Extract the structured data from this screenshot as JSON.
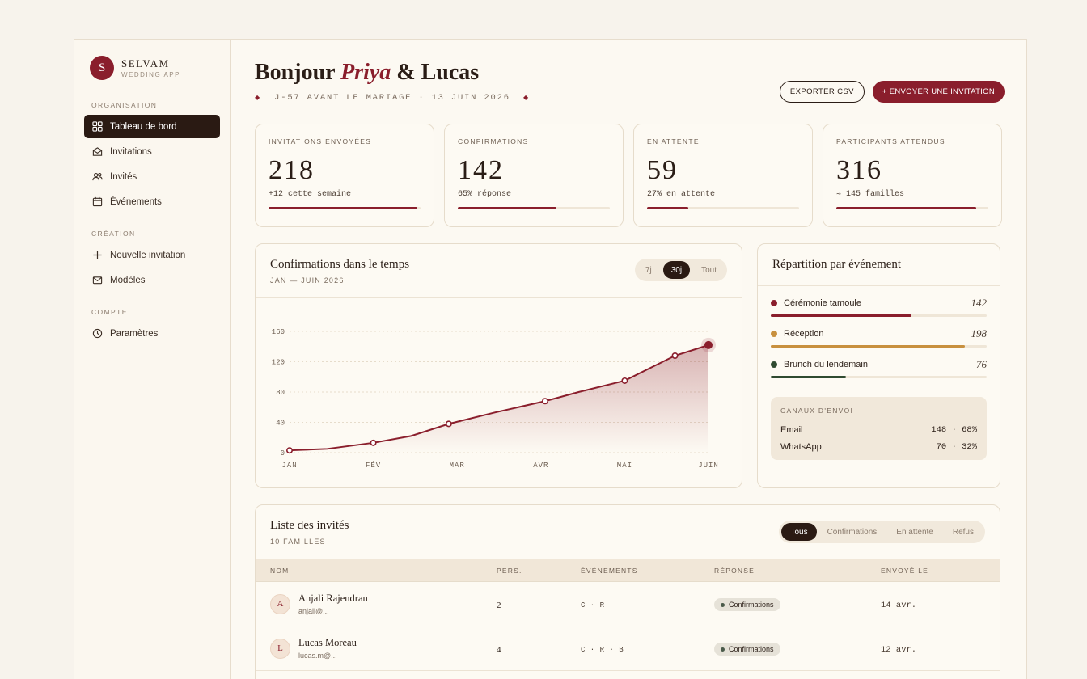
{
  "brand": {
    "initial": "S",
    "name": "SELVAM",
    "sub": "WEDDING APP"
  },
  "sidebar": {
    "sections": [
      {
        "title": "ORGANISATION",
        "items": [
          {
            "label": "Tableau de bord",
            "icon": "grid-icon",
            "active": true
          },
          {
            "label": "Invitations",
            "icon": "envelope-icon"
          },
          {
            "label": "Invités",
            "icon": "users-icon"
          },
          {
            "label": "Événements",
            "icon": "calendar-icon"
          }
        ]
      },
      {
        "title": "CRÉATION",
        "items": [
          {
            "label": "Nouvelle invitation",
            "icon": "plus-icon"
          },
          {
            "label": "Modèles",
            "icon": "mail-icon"
          }
        ]
      },
      {
        "title": "COMPTE",
        "items": [
          {
            "label": "Paramètres",
            "icon": "clock-icon"
          }
        ]
      }
    ]
  },
  "header": {
    "hello": "Bonjour ",
    "name1": "Priya",
    "amp": " & Lucas",
    "countdown": "J-57 AVANT LE MARIAGE · 13 JUIN 2026",
    "export_label": "EXPORTER CSV",
    "send_label": "+ ENVOYER UNE INVITATION"
  },
  "stats": [
    {
      "label": "INVITATIONS ENVOYÉES",
      "value": "218",
      "sub": "+12 cette semaine",
      "progress": 0.98
    },
    {
      "label": "CONFIRMATIONS",
      "value": "142",
      "sub": "65% réponse",
      "progress": 0.65
    },
    {
      "label": "EN ATTENTE",
      "value": "59",
      "sub": "27% en attente",
      "progress": 0.27
    },
    {
      "label": "PARTICIPANTS ATTENDUS",
      "value": "316",
      "sub": "≈ 145 familles",
      "progress": 0.92
    }
  ],
  "chart_panel": {
    "title": "Confirmations dans le temps",
    "sub": "JAN — JUIN 2026",
    "ranges": [
      "7j",
      "30j",
      "Tout"
    ],
    "active_range": "30j"
  },
  "chart_data": {
    "type": "area",
    "x": [
      "JAN",
      "JAN",
      "FÉV",
      "FÉV",
      "MAR",
      "MAR",
      "AVR",
      "AVR",
      "MAI",
      "MAI",
      "JUIN"
    ],
    "x_pos": [
      0,
      0.45,
      1,
      1.45,
      1.9,
      2.45,
      3.05,
      3.45,
      4.0,
      4.6,
      5.0
    ],
    "values": [
      3,
      5,
      13,
      22,
      38,
      53,
      68,
      80,
      95,
      128,
      142
    ],
    "markers": [
      true,
      false,
      true,
      false,
      true,
      false,
      true,
      false,
      true,
      true,
      true
    ],
    "tick_labels": [
      "JAN",
      "FÉV",
      "MAR",
      "AVR",
      "MAI",
      "JUIN"
    ],
    "yticks": [
      0,
      40,
      80,
      120,
      160
    ],
    "ylim": [
      0,
      160
    ],
    "grid": true,
    "color": "#8a1e2c"
  },
  "distribution": {
    "title": "Répartition par événement",
    "items": [
      {
        "label": "Cérémonie tamoule",
        "value": "142",
        "share": 0.65,
        "color": "#8a1e2c"
      },
      {
        "label": "Réception",
        "value": "198",
        "share": 0.9,
        "color": "#c8903e"
      },
      {
        "label": "Brunch du lendemain",
        "value": "76",
        "share": 0.35,
        "color": "#2f4a30"
      }
    ],
    "channels_title": "CANAUX D'ENVOI",
    "channels": [
      {
        "label": "Email",
        "value": "148 · 68%"
      },
      {
        "label": "WhatsApp",
        "value": "70 · 32%"
      }
    ]
  },
  "guests": {
    "title": "Liste des invités",
    "sub": "10 FAMILLES",
    "filters": [
      "Tous",
      "Confirmations",
      "En attente",
      "Refus"
    ],
    "active_filter": "Tous",
    "columns": [
      "NOM",
      "PERS.",
      "ÉVÉNEMENTS",
      "RÉPONSE",
      "ENVOYÉ LE"
    ],
    "rows": [
      {
        "initial": "A",
        "name": "Anjali Rajendran",
        "email": "anjali@...",
        "pers": "2",
        "events": "C · R",
        "status": "Confirmations",
        "date": "14 avr."
      },
      {
        "initial": "L",
        "name": "Lucas Moreau",
        "email": "lucas.m@...",
        "pers": "4",
        "events": "C · R · B",
        "status": "Confirmations",
        "date": "12 avr."
      }
    ]
  },
  "colors": {
    "accent": "#8a1e2c",
    "dark": "#2a1a13",
    "gold": "#c8903e",
    "green": "#2f4a30"
  }
}
